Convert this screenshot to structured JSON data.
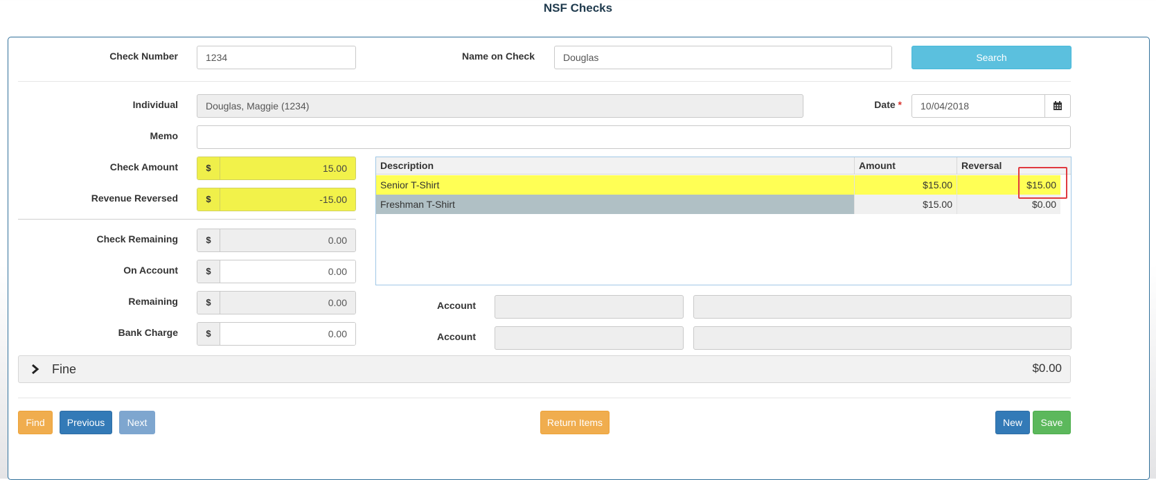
{
  "page": {
    "title": "NSF Checks"
  },
  "search": {
    "check_number_label": "Check Number",
    "check_number_value": "1234",
    "name_on_check_label": "Name on Check",
    "name_on_check_value": "Douglas",
    "search_button": "Search"
  },
  "details": {
    "individual_label": "Individual",
    "individual_value": "Douglas, Maggie (1234)",
    "date_label": "Date",
    "date_required": "*",
    "date_value": "10/04/2018",
    "memo_label": "Memo",
    "memo_value": ""
  },
  "amounts": {
    "currency_symbol": "$",
    "check_amount_label": "Check Amount",
    "check_amount_value": "15.00",
    "revenue_reversed_label": "Revenue Reversed",
    "revenue_reversed_value": "-15.00",
    "check_remaining_label": "Check Remaining",
    "check_remaining_value": "0.00",
    "on_account_label": "On Account",
    "on_account_value": "0.00",
    "remaining_label": "Remaining",
    "remaining_value": "0.00",
    "bank_charge_label": "Bank Charge",
    "bank_charge_value": "0.00"
  },
  "grid": {
    "columns": [
      "Description",
      "Amount",
      "Reversal"
    ],
    "rows": [
      {
        "description": "Senior T-Shirt",
        "amount": "$15.00",
        "reversal": "$15.00"
      },
      {
        "description": "Freshman T-Shirt",
        "amount": "$15.00",
        "reversal": "$0.00"
      }
    ]
  },
  "accounts": {
    "account1_label": "Account",
    "account2_label": "Account"
  },
  "fine": {
    "label": "Fine",
    "total": "$0.00",
    "icon": "chevron-right-icon"
  },
  "footer": {
    "find": "Find",
    "previous": "Previous",
    "next": "Next",
    "return_items": "Return Items",
    "new": "New",
    "save": "Save"
  },
  "colors": {
    "highlight_yellow": "#ffff55",
    "panel_border": "#2f6f9a",
    "info": "#5bc0de",
    "warning": "#f0ad4e",
    "primary": "#337ab7",
    "success": "#5cb85c",
    "annotation_red": "#e0393e"
  }
}
